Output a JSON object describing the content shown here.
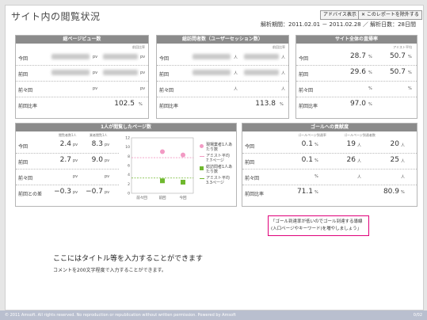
{
  "header": {
    "title": "サイト内の閲覧状況",
    "advice_btn": "アドバイス表示",
    "exclude_btn": "✕ このレポートを除外する",
    "period": "解析期間：2011.02.01 － 2011.02.28 ／ 解析日数：28日間"
  },
  "pv_panel": {
    "title": "総ページビュー数",
    "subhead": "前回比率",
    "rows": [
      {
        "label": "今回",
        "u1": "pv",
        "u2": "pv"
      },
      {
        "label": "前回",
        "u1": "pv",
        "u2": "pv"
      },
      {
        "label": "前々回",
        "u1": "pv",
        "u2": "pv"
      },
      {
        "label": "前回比率",
        "value": "102.5",
        "unit": "%"
      }
    ]
  },
  "visit_panel": {
    "title": "総訪問者数（ユーザーセッション数）",
    "subhead": "前回比率",
    "rows": [
      {
        "label": "今回",
        "u1": "人",
        "u2": "人"
      },
      {
        "label": "前回",
        "u1": "人",
        "u2": "人"
      },
      {
        "label": "前々回",
        "u1": "人",
        "u2": "人"
      },
      {
        "label": "前回比率",
        "value": "113.8",
        "unit": "%"
      }
    ]
  },
  "bounce_panel": {
    "title": "サイト全体の直帰率",
    "subhead": "アミスト平均",
    "rows": [
      {
        "label": "今回",
        "v1": "28.7",
        "v2": "50.7"
      },
      {
        "label": "前回",
        "v1": "29.6",
        "v2": "50.7"
      },
      {
        "label": "前々回",
        "v1": "",
        "v2": ""
      },
      {
        "label": "前回比率",
        "v1": "97.0",
        "v2": ""
      }
    ],
    "unit": "%"
  },
  "pages_panel": {
    "title": "1人が閲覧したページ数",
    "col1": "閲覧者数1人",
    "col2": "業者閲覧1人",
    "unit": "pv",
    "rows": [
      {
        "label": "今回",
        "v1": "2.4",
        "v2": "8.3"
      },
      {
        "label": "前回",
        "v1": "2.7",
        "v2": "9.0"
      },
      {
        "label": "前々回",
        "v1": "",
        "v2": ""
      },
      {
        "label": "前回との差",
        "v1": "−0.3",
        "v2": "−0.7"
      }
    ],
    "legend": [
      {
        "label": "現場業者1人あたり数",
        "color": "#f29ac4"
      },
      {
        "label": "アミスト平均7.7ページ",
        "color": "#f29ac4"
      },
      {
        "label": "総訪問者1人あたり数",
        "color": "#6fb82e"
      },
      {
        "label": "アミスト平均3.3ページ",
        "color": "#6fb82e"
      }
    ]
  },
  "chart_data": {
    "type": "scatter",
    "categories": [
      "前々回",
      "前回",
      "今回"
    ],
    "y_ticks": [
      "12",
      "10",
      "8",
      "6",
      "4",
      "2",
      "0"
    ],
    "ylim": [
      0,
      12
    ],
    "series": [
      {
        "name": "現場業者1人あたり数",
        "values": [
          null,
          9.0,
          8.3
        ],
        "color": "#f29ac4",
        "marker": "circle"
      },
      {
        "name": "総訪問者1人あたり数",
        "values": [
          null,
          2.7,
          2.4
        ],
        "color": "#6fb82e",
        "marker": "square"
      }
    ],
    "reference_lines": [
      {
        "name": "アミスト平均7.7ページ",
        "value": 7.7,
        "color": "#f29ac4"
      },
      {
        "name": "アミスト平均3.3ページ",
        "value": 3.3,
        "color": "#6fb82e"
      }
    ]
  },
  "goal_panel": {
    "title": "ゴールへの貢献度",
    "col1": "ゴールページ到達率",
    "col2": "ゴールページ到達者数",
    "rows": [
      {
        "label": "今回",
        "v1": "0.1",
        "u1": "%",
        "v2": "19",
        "u2": "人",
        "v3": "20",
        "u3": "人"
      },
      {
        "label": "前回",
        "v1": "0.1",
        "u1": "%",
        "v2": "26",
        "u2": "人",
        "v3": "25",
        "u3": "人"
      },
      {
        "label": "前々回",
        "v1": "",
        "u1": "%",
        "v2": "",
        "u2": "人",
        "v3": "",
        "u3": "人"
      },
      {
        "label": "前回比率",
        "v1": "71.1",
        "u1": "%",
        "v2": "",
        "u2": "",
        "v3": "80.9",
        "u3": "%"
      }
    ]
  },
  "note": "「ゴール到達率が低いのでゴール到達する導線(入口ページやキーワード)を増やしましょう」",
  "title_area": {
    "title": "ここにはタイトル等を入力することができます",
    "comment": "コメントを200文字程度で入力することができます。"
  },
  "footer": {
    "copyright": "© 2011 Amsoft. All rights reserved. No reproduction or republication without written permission. Powered by Amsoft",
    "page_no": "0/02"
  }
}
